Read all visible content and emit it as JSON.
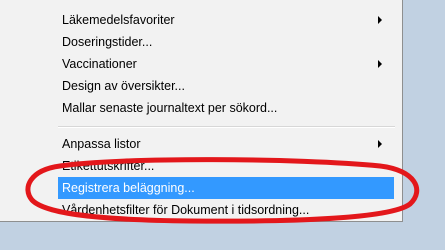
{
  "menu": {
    "items": [
      {
        "label": "Läkemedelsfavoriter",
        "submenu": true
      },
      {
        "label": "Doseringstider...",
        "submenu": false
      },
      {
        "label": "Vaccinationer",
        "submenu": true
      },
      {
        "label": "Design av översikter...",
        "submenu": false
      },
      {
        "label": "Mallar senaste journaltext per sökord...",
        "submenu": false
      },
      {
        "label": "Anpassa listor",
        "submenu": true
      },
      {
        "label": "Etikettutskrifter...",
        "submenu": false
      },
      {
        "label": "Registrera beläggning...",
        "submenu": false,
        "selected": true
      },
      {
        "label": "Vårdenhetsfilter för Dokument i tidsordning...",
        "submenu": false
      }
    ]
  },
  "colors": {
    "selection": "#3399ff",
    "annotation": "#e3171b",
    "menu_bg": "#f2f2f2",
    "desktop": "#c1d1e2"
  },
  "icons": {
    "submenu": "submenu-arrow-icon"
  }
}
